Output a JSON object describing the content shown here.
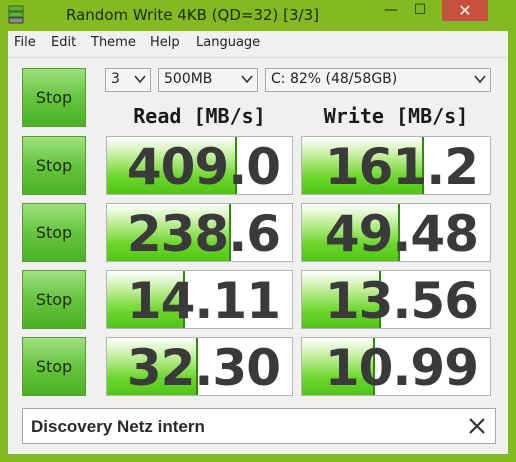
{
  "window": {
    "title": "Random Write 4KB (QD=32) [3/3]",
    "minimize_glyph": "—",
    "maximize_glyph": "☐",
    "close_glyph": "✕"
  },
  "menu": {
    "items": [
      "File",
      "Edit",
      "Theme",
      "Help",
      "Language"
    ]
  },
  "controls": {
    "count": "3",
    "size": "500MB",
    "drive": "C: 82% (48/58GB)",
    "all_label": "Stop"
  },
  "headers": {
    "read": "Read [MB/s]",
    "write": "Write [MB/s]"
  },
  "rows": [
    {
      "stop_label": "Stop",
      "read": "409.0",
      "write": "161.2",
      "read_fill": 0.7,
      "write_fill": 0.65
    },
    {
      "stop_label": "Stop",
      "read": "238.6",
      "write": "49.48",
      "read_fill": 0.67,
      "write_fill": 0.52
    },
    {
      "stop_label": "Stop",
      "read": "14.11",
      "write": "13.56",
      "read_fill": 0.42,
      "write_fill": 0.42
    },
    {
      "stop_label": "Stop",
      "read": "32.30",
      "write": "10.99",
      "read_fill": 0.49,
      "write_fill": 0.39
    }
  ],
  "comment": {
    "value": "Discovery Netz intern"
  },
  "colors": {
    "frame": "#83ba1f",
    "fill_green": "#52c41a",
    "close_red": "#c7503f"
  }
}
